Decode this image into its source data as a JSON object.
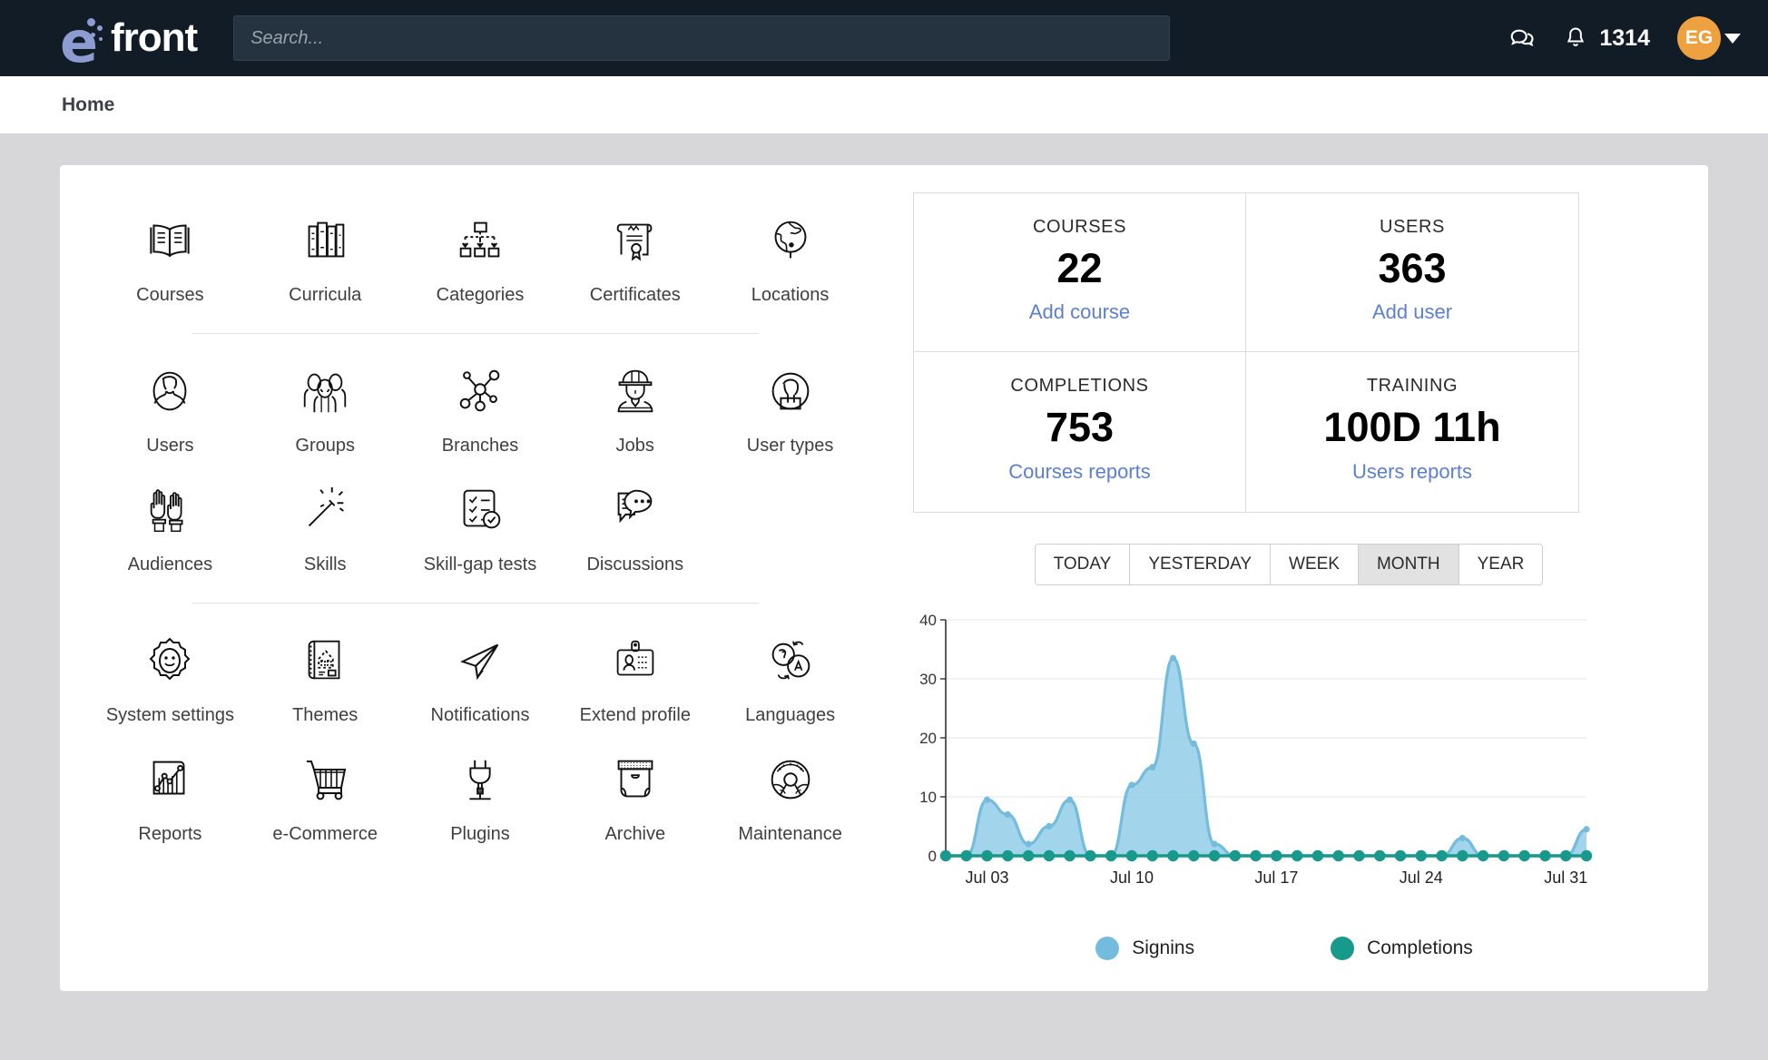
{
  "brand": {
    "name": "efront",
    "logo_letter": "e"
  },
  "search": {
    "placeholder": "Search...",
    "value": ""
  },
  "header": {
    "messages_icon": "chat-bubbles-icon",
    "notifications_icon": "bell-icon",
    "notification_count": "1314",
    "avatar_initials": "EG",
    "caret_icon": "chevron-down-icon"
  },
  "breadcrumb": {
    "current": "Home"
  },
  "tiles": {
    "group1": [
      {
        "label": "Courses",
        "icon": "open-book-icon"
      },
      {
        "label": "Curricula",
        "icon": "books-shelf-icon"
      },
      {
        "label": "Categories",
        "icon": "hierarchy-folders-icon"
      },
      {
        "label": "Certificates",
        "icon": "certificate-scroll-icon"
      },
      {
        "label": "Locations",
        "icon": "globe-icon"
      }
    ],
    "group2": [
      {
        "label": "Users",
        "icon": "person-oval-icon"
      },
      {
        "label": "Groups",
        "icon": "people-group-icon"
      },
      {
        "label": "Branches",
        "icon": "network-nodes-icon"
      },
      {
        "label": "Jobs",
        "icon": "hardhat-worker-icon"
      },
      {
        "label": "User types",
        "icon": "person-badge-circle-icon"
      },
      {
        "label": "Audiences",
        "icon": "raised-hands-icon"
      },
      {
        "label": "Skills",
        "icon": "magic-wand-icon"
      },
      {
        "label": "Skill-gap tests",
        "icon": "checklist-check-icon"
      },
      {
        "label": "Discussions",
        "icon": "speech-bubbles-icon"
      },
      {
        "label": "",
        "icon": ""
      }
    ],
    "group3": [
      {
        "label": "System settings",
        "icon": "gear-smiley-icon"
      },
      {
        "label": "Themes",
        "icon": "blueprint-scroll-icon"
      },
      {
        "label": "Notifications",
        "icon": "paper-plane-icon"
      },
      {
        "label": "Extend profile",
        "icon": "id-badge-icon"
      },
      {
        "label": "Languages",
        "icon": "translate-icon"
      },
      {
        "label": "Reports",
        "icon": "bar-line-chart-icon"
      },
      {
        "label": "e-Commerce",
        "icon": "shopping-cart-icon"
      },
      {
        "label": "Plugins",
        "icon": "power-plug-icon"
      },
      {
        "label": "Archive",
        "icon": "archive-box-icon"
      },
      {
        "label": "Maintenance",
        "icon": "gauge-meter-icon"
      }
    ]
  },
  "stats": [
    {
      "label": "COURSES",
      "value": "22",
      "link": "Add course"
    },
    {
      "label": "USERS",
      "value": "363",
      "link": "Add user"
    },
    {
      "label": "COMPLETIONS",
      "value": "753",
      "link": "Courses reports"
    },
    {
      "label": "TRAINING",
      "value": "100D 11h",
      "link": "Users reports"
    }
  ],
  "periods": [
    {
      "label": "TODAY",
      "active": false
    },
    {
      "label": "YESTERDAY",
      "active": false
    },
    {
      "label": "WEEK",
      "active": false
    },
    {
      "label": "MONTH",
      "active": true
    },
    {
      "label": "YEAR",
      "active": false
    }
  ],
  "colors": {
    "signins": "#73bcdd",
    "signins_fill": "#8ecbe6",
    "completions": "#17998b",
    "accent_link": "#5b7fd4",
    "avatar": "#eda13f",
    "topbar": "#111c26"
  },
  "chart_data": {
    "type": "area",
    "title": "",
    "xlabel": "",
    "ylabel": "",
    "ylim": [
      0,
      40
    ],
    "yticks": [
      0,
      10,
      20,
      30,
      40
    ],
    "grid": true,
    "legend_position": "bottom",
    "x": [
      "Jul 01",
      "Jul 02",
      "Jul 03",
      "Jul 04",
      "Jul 05",
      "Jul 06",
      "Jul 07",
      "Jul 08",
      "Jul 09",
      "Jul 10",
      "Jul 11",
      "Jul 12",
      "Jul 13",
      "Jul 14",
      "Jul 15",
      "Jul 16",
      "Jul 17",
      "Jul 18",
      "Jul 19",
      "Jul 20",
      "Jul 21",
      "Jul 22",
      "Jul 23",
      "Jul 24",
      "Jul 25",
      "Jul 26",
      "Jul 27",
      "Jul 28",
      "Jul 29",
      "Jul 30",
      "Jul 31",
      "Aug 01"
    ],
    "xtick_labels": [
      "Jul 03",
      "Jul 10",
      "Jul 17",
      "Jul 24",
      "Jul 31"
    ],
    "xtick_indices": [
      2,
      9,
      16,
      23,
      30
    ],
    "series": [
      {
        "name": "Signins",
        "color": "#73bcdd",
        "values": [
          0,
          0,
          9.5,
          7,
          2,
          5,
          9.5,
          0,
          0,
          12,
          15,
          33.5,
          19,
          2,
          0,
          0,
          0,
          0,
          0,
          0,
          0,
          0,
          0,
          0,
          0,
          3,
          0,
          0,
          0,
          0,
          0,
          4.5
        ]
      },
      {
        "name": "Completions",
        "color": "#17998b",
        "values": [
          0,
          0,
          0,
          0,
          0,
          0,
          0,
          0,
          0,
          0,
          0,
          0,
          0,
          0,
          0,
          0,
          0,
          0,
          0,
          0,
          0,
          0,
          0,
          0,
          0,
          0,
          0,
          0,
          0,
          0,
          0,
          0
        ]
      }
    ]
  }
}
